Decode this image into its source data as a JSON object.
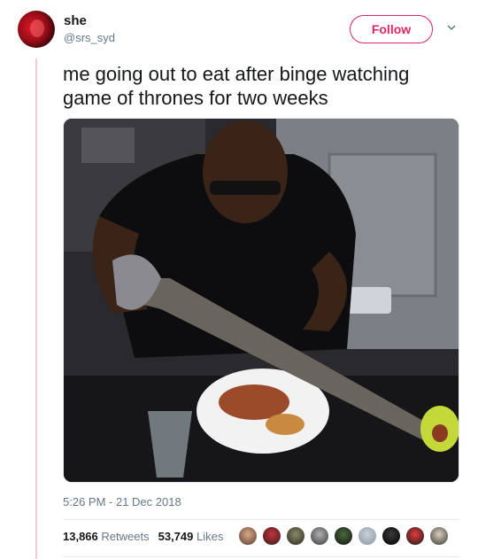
{
  "user": {
    "display_name": "she",
    "handle": "@srs_syd"
  },
  "follow_label": "Follow",
  "tweet": {
    "text": "me going out to eat after binge watching game of thrones for two weeks",
    "timestamp": "5:26 PM - 21 Dec 2018"
  },
  "stats": {
    "retweets_count": "13,866",
    "retweets_label": "Retweets",
    "likes_count": "53,749",
    "likes_label": "Likes"
  },
  "colors": {
    "accent": "#e0245e",
    "muted": "#657786",
    "text": "#14171a",
    "thread_line": "#f5c8d6"
  },
  "icons": {
    "menu": "chevron-down-icon"
  }
}
